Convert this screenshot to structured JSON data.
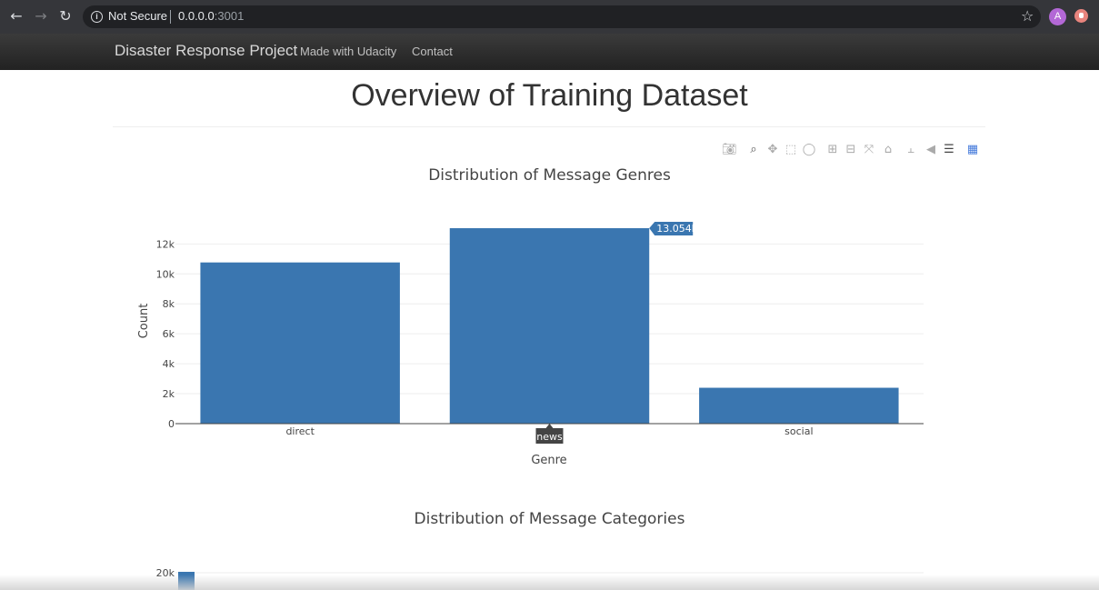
{
  "browser": {
    "security_label": "Not Secure",
    "url_host": "0.0.0.0",
    "url_port": ":3001",
    "avatar_letter": "A"
  },
  "navbar": {
    "brand": "Disaster Response Project",
    "links": [
      "Made with Udacity",
      "Contact"
    ]
  },
  "page": {
    "title": "Overview of Training Dataset"
  },
  "chart_data": [
    {
      "type": "bar",
      "title": "Distribution of Message Genres",
      "xlabel": "Genre",
      "ylabel": "Count",
      "categories": [
        "direct",
        "news",
        "social"
      ],
      "values": [
        10766,
        13054,
        2396
      ],
      "ylim": [
        0,
        13054
      ],
      "yticks": [
        0,
        2000,
        4000,
        6000,
        8000,
        10000,
        12000
      ],
      "ytick_labels": [
        "0",
        "2k",
        "4k",
        "6k",
        "8k",
        "10k",
        "12k"
      ],
      "grid": true,
      "color": "#3a76b0",
      "hover": {
        "category": "news",
        "value_label": "13.054k"
      }
    },
    {
      "type": "bar",
      "title": "Distribution of Message Categories",
      "ytick_labels": [
        "20k"
      ],
      "color": "#3a76b0"
    }
  ]
}
